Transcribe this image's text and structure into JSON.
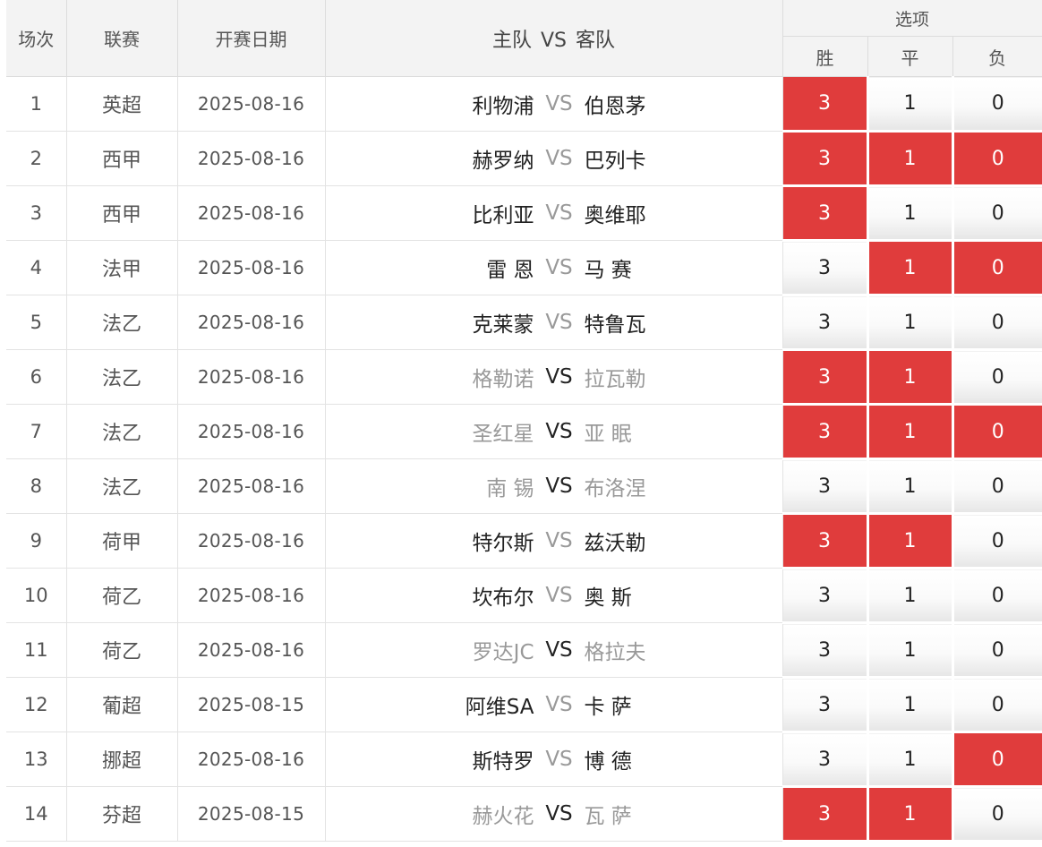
{
  "header": {
    "no": "场次",
    "league": "联赛",
    "date": "开赛日期",
    "home": "主队",
    "vs": "VS",
    "away": "客队",
    "options_group": "选项",
    "win": "胜",
    "draw": "平",
    "lose": "负"
  },
  "colors": {
    "selected": "#e03c3c",
    "header_bg": "#f3f3f3"
  },
  "rows": [
    {
      "no": "1",
      "league": "英超",
      "date": "2025-08-16",
      "home": "利物浦",
      "vs": "VS",
      "away": "伯恩茅",
      "win": "3",
      "draw": "1",
      "lose": "0",
      "sel": [
        true,
        false,
        false
      ],
      "tone": [
        "dark",
        "gray",
        "dark"
      ]
    },
    {
      "no": "2",
      "league": "西甲",
      "date": "2025-08-16",
      "home": "赫罗纳",
      "vs": "VS",
      "away": "巴列卡",
      "win": "3",
      "draw": "1",
      "lose": "0",
      "sel": [
        true,
        true,
        true
      ],
      "tone": [
        "dark",
        "gray",
        "dark"
      ]
    },
    {
      "no": "3",
      "league": "西甲",
      "date": "2025-08-16",
      "home": "比利亚",
      "vs": "VS",
      "away": "奥维耶",
      "win": "3",
      "draw": "1",
      "lose": "0",
      "sel": [
        true,
        false,
        false
      ],
      "tone": [
        "dark",
        "gray",
        "dark"
      ]
    },
    {
      "no": "4",
      "league": "法甲",
      "date": "2025-08-16",
      "home": "雷 恩",
      "vs": "VS",
      "away": "马 赛",
      "win": "3",
      "draw": "1",
      "lose": "0",
      "sel": [
        false,
        true,
        true
      ],
      "tone": [
        "dark",
        "gray",
        "dark"
      ]
    },
    {
      "no": "5",
      "league": "法乙",
      "date": "2025-08-16",
      "home": "克莱蒙",
      "vs": "VS",
      "away": "特鲁瓦",
      "win": "3",
      "draw": "1",
      "lose": "0",
      "sel": [
        false,
        false,
        false
      ],
      "tone": [
        "dark",
        "gray",
        "dark"
      ]
    },
    {
      "no": "6",
      "league": "法乙",
      "date": "2025-08-16",
      "home": "格勒诺",
      "vs": "VS",
      "away": "拉瓦勒",
      "win": "3",
      "draw": "1",
      "lose": "0",
      "sel": [
        true,
        true,
        false
      ],
      "tone": [
        "gray",
        "dark",
        "gray"
      ]
    },
    {
      "no": "7",
      "league": "法乙",
      "date": "2025-08-16",
      "home": "圣红星",
      "vs": "VS",
      "away": "亚 眠",
      "win": "3",
      "draw": "1",
      "lose": "0",
      "sel": [
        true,
        true,
        true
      ],
      "tone": [
        "gray",
        "dark",
        "gray"
      ]
    },
    {
      "no": "8",
      "league": "法乙",
      "date": "2025-08-16",
      "home": "南 锡",
      "vs": "VS",
      "away": "布洛涅",
      "win": "3",
      "draw": "1",
      "lose": "0",
      "sel": [
        false,
        false,
        false
      ],
      "tone": [
        "gray",
        "dark",
        "gray"
      ]
    },
    {
      "no": "9",
      "league": "荷甲",
      "date": "2025-08-16",
      "home": "特尔斯",
      "vs": "VS",
      "away": "兹沃勒",
      "win": "3",
      "draw": "1",
      "lose": "0",
      "sel": [
        true,
        true,
        false
      ],
      "tone": [
        "dark",
        "gray",
        "dark"
      ]
    },
    {
      "no": "10",
      "league": "荷乙",
      "date": "2025-08-16",
      "home": "坎布尔",
      "vs": "VS",
      "away": "奥 斯",
      "win": "3",
      "draw": "1",
      "lose": "0",
      "sel": [
        false,
        false,
        false
      ],
      "tone": [
        "dark",
        "gray",
        "dark"
      ]
    },
    {
      "no": "11",
      "league": "荷乙",
      "date": "2025-08-16",
      "home": "罗达JC",
      "vs": "VS",
      "away": "格拉夫",
      "win": "3",
      "draw": "1",
      "lose": "0",
      "sel": [
        false,
        false,
        false
      ],
      "tone": [
        "gray",
        "dark",
        "gray"
      ]
    },
    {
      "no": "12",
      "league": "葡超",
      "date": "2025-08-15",
      "home": "阿维SA",
      "vs": "VS",
      "away": "卡 萨",
      "win": "3",
      "draw": "1",
      "lose": "0",
      "sel": [
        false,
        false,
        false
      ],
      "tone": [
        "dark",
        "gray",
        "dark"
      ]
    },
    {
      "no": "13",
      "league": "挪超",
      "date": "2025-08-16",
      "home": "斯特罗",
      "vs": "VS",
      "away": "博 德",
      "win": "3",
      "draw": "1",
      "lose": "0",
      "sel": [
        false,
        false,
        true
      ],
      "tone": [
        "dark",
        "gray",
        "dark"
      ]
    },
    {
      "no": "14",
      "league": "芬超",
      "date": "2025-08-15",
      "home": "赫火花",
      "vs": "VS",
      "away": "瓦 萨",
      "win": "3",
      "draw": "1",
      "lose": "0",
      "sel": [
        true,
        true,
        false
      ],
      "tone": [
        "gray",
        "dark",
        "gray"
      ]
    }
  ]
}
